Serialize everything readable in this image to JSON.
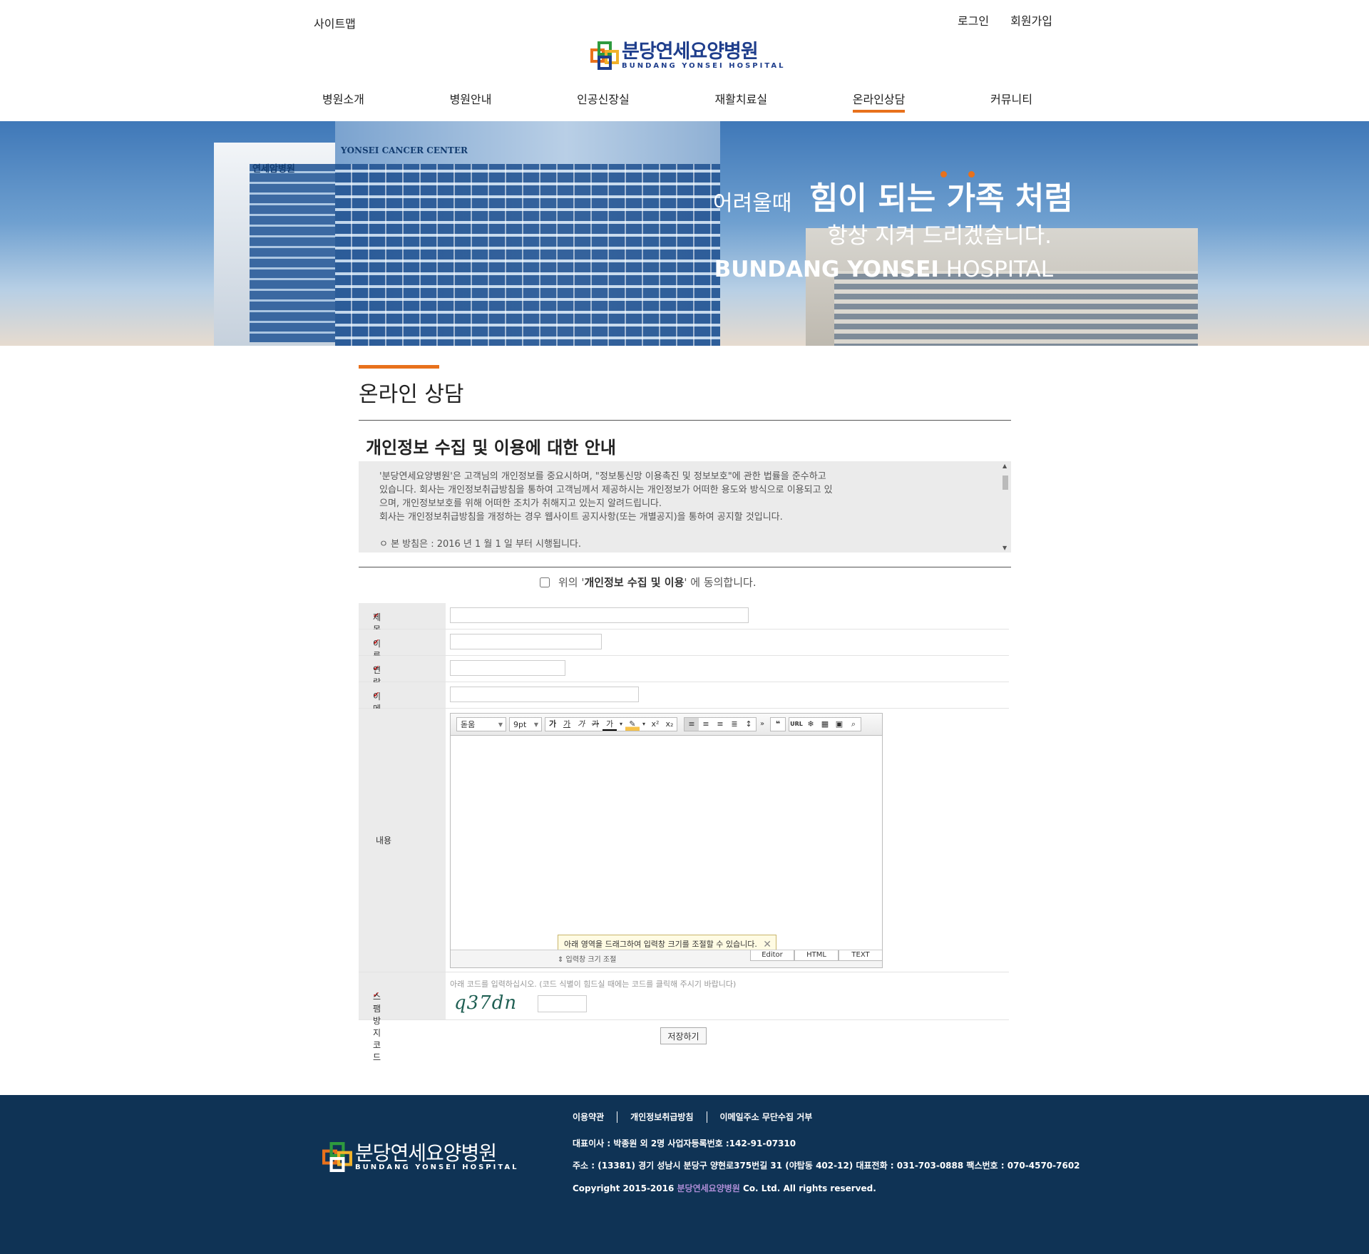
{
  "header": {
    "sitemap": "사이트맵",
    "login": "로그인",
    "signup": "회원가입",
    "logo_ko": "분당연세요양병원",
    "logo_en": "BUNDANG YONSEI HOSPITAL"
  },
  "nav": {
    "items": [
      "병원소개",
      "병원안내",
      "인공신장실",
      "재활치료실",
      "온라인상담",
      "커뮤니티"
    ],
    "active": "온라인상담"
  },
  "banner": {
    "sign1": "YONSEI CANCER CENTER",
    "sign2": "연세암병원",
    "slogan1a": "어려울때",
    "slogan1b": "힘이 되는 가족 처럼",
    "slogan2": "항상 지켜 드리겠습니다.",
    "slogan3_bold": "BUNDANG YONSEI",
    "slogan3_light": " HOSPITAL"
  },
  "page": {
    "title": "온라인 상담",
    "privacy_heading": "개인정보 수집 및 이용에 대한 안내",
    "privacy_lines": [
      "'분당연세요양병원'은 고객님의 개인정보를 중요시하며, \"정보통신망 이용촉진 및 정보보호\"에 관한 법률을 준수하고",
      "있습니다. 회사는 개인정보취급방침을 통하여 고객님께서 제공하시는 개인정보가 어떠한 용도와 방식으로 이용되고 있",
      "으며, 개인정보보호를 위해 어떠한 조치가 취해지고 있는지 알려드립니다.",
      "회사는 개인정보취급방침을 개정하는 경우 웹사이트 공지사항(또는 개별공지)을 통하여 공지할 것입니다.",
      "",
      "ㅇ 본 방침은 : 2016 년 1 월 1 일 부터 시행됩니다."
    ],
    "agree_prefix": "위의 '",
    "agree_bold": "개인정보 수집 및 이용",
    "agree_suffix": "' 에 동의합니다."
  },
  "form": {
    "title_label": "제목",
    "name_label": "이름",
    "phone_label": "연락처",
    "email_label": "이메일",
    "content_label": "내용",
    "spam_label": "스팸방지코드",
    "check_mark": "✔",
    "editor": {
      "font": "돋움",
      "size": "9pt",
      "resize_hint": "⇕ 입력창 크기 조절",
      "tooltip": "아래 영역을 드래그하여 입력창 크기를 조절할 수 있습니다.",
      "tabs": [
        "Editor",
        "HTML",
        "TEXT"
      ]
    },
    "captcha_note": "아래 코드를 입력하십시오. (코드 식별이 힘드실 때에는 코드를 클릭해 주시기 바랍니다)",
    "captcha_code": "q37dn",
    "save": "저장하기"
  },
  "footer": {
    "links": [
      "이용약관",
      "개인정보취급방침",
      "이메일주소 무단수집 거부"
    ],
    "ceo": "대표이사 : 박종원 외 2명 사업자등록번호 :142-91-07310",
    "address": "주소 : (13381) 경기 성남시 분당구 양현로375번길 31 (야탑동 402-12)  대표전화 : 031-703-0888  팩스번호 : 070-4570-7602",
    "copyright_prefix": "Copyright 2015-2016 ",
    "copyright_name": "분당연세요양병원",
    "copyright_suffix": " Co. Ltd. All rights reserved.",
    "logo_ko": "분당연세요양병원",
    "logo_en": "BUNDANG YONSEI HOSPITAL"
  },
  "colors": {
    "accent": "#e8711c",
    "brand_blue": "#1f3e8c",
    "footer_bg": "#0f3355"
  }
}
